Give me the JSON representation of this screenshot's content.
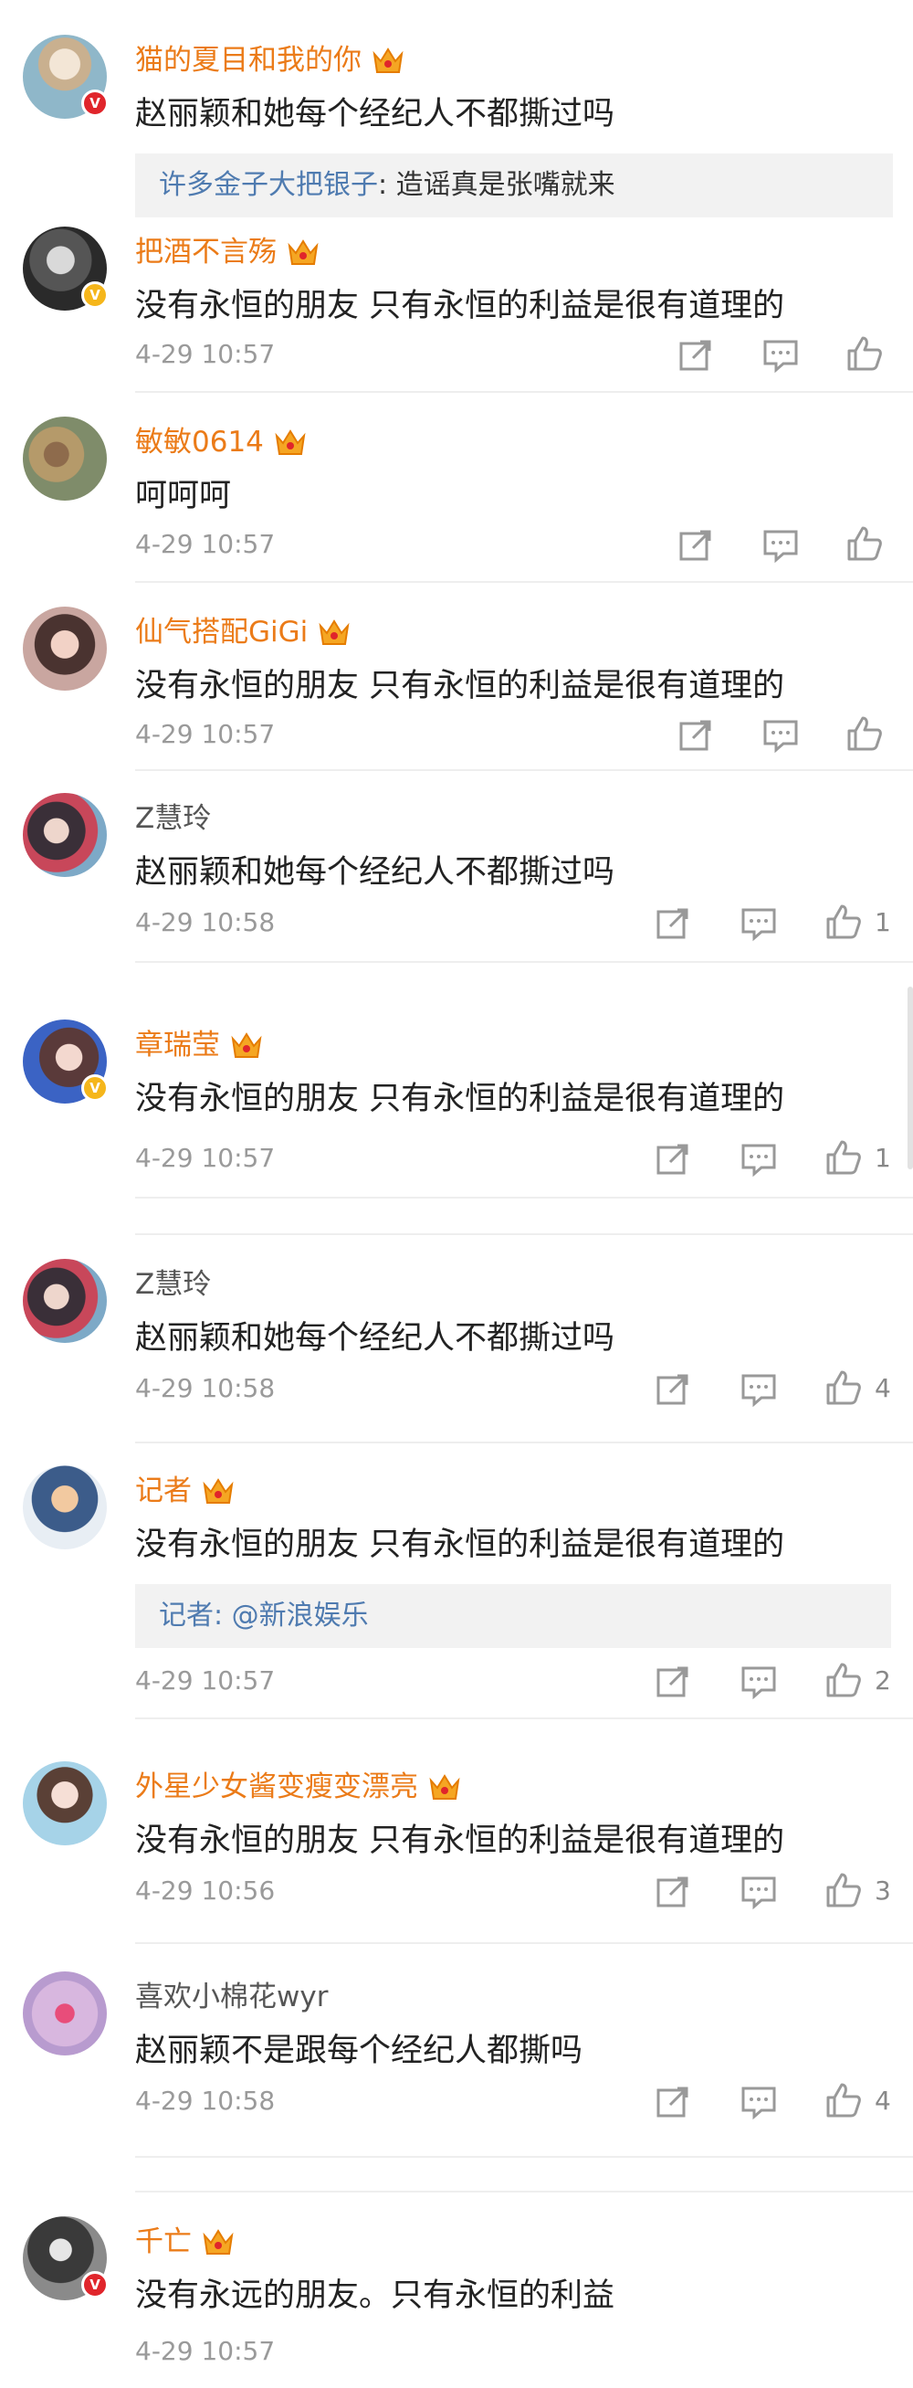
{
  "comments": [
    {
      "name": "猫的夏目和我的你",
      "vip": true,
      "badge": "red",
      "text": "赵丽颖和她每个经纪人不都撕过吗",
      "reply": {
        "name": "许多金子大把银子",
        "text": ": 造谣真是张嘴就来"
      },
      "time": "",
      "likes": ""
    },
    {
      "name": "把酒不言殇",
      "vip": true,
      "badge": "gold",
      "text": "没有永恒的朋友 只有永恒的利益是很有道理的",
      "time": "4-29 10:57",
      "likes": ""
    },
    {
      "name": "敏敏0614",
      "vip": true,
      "badge": "",
      "text": "呵呵呵",
      "time": "4-29 10:57",
      "likes": ""
    },
    {
      "name": "仙气搭配GiGi",
      "vip": true,
      "badge": "",
      "text": "没有永恒的朋友 只有永恒的利益是很有道理的",
      "time": "4-29 10:57",
      "likes": ""
    },
    {
      "name": "Z慧玲",
      "vip": false,
      "badge": "",
      "text": "赵丽颖和她每个经纪人不都撕过吗",
      "time": "4-29 10:58",
      "likes": "1"
    },
    {
      "name": "章瑞莹",
      "vip": true,
      "badge": "gold",
      "text": "没有永恒的朋友 只有永恒的利益是很有道理的",
      "time": "4-29 10:57",
      "likes": "1"
    },
    {
      "name": "Z慧玲",
      "vip": false,
      "badge": "",
      "text": "赵丽颖和她每个经纪人不都撕过吗",
      "time": "4-29 10:58",
      "likes": "4"
    },
    {
      "name": "记者",
      "vip": true,
      "badge": "",
      "text": "没有永恒的朋友 只有永恒的利益是很有道理的",
      "reply": {
        "name": "记者",
        "text": ": @新浪娱乐"
      },
      "time": "4-29 10:57",
      "likes": "2"
    },
    {
      "name": "外星少女酱变瘦变漂亮",
      "vip": true,
      "badge": "",
      "text": "没有永恒的朋友 只有永恒的利益是很有道理的",
      "time": "4-29 10:56",
      "likes": "3"
    },
    {
      "name": "喜欢小棉花wyr",
      "vip": false,
      "badge": "",
      "text": "赵丽颖不是跟每个经纪人都撕吗",
      "time": "4-29 10:58",
      "likes": "4"
    },
    {
      "name": "千亡",
      "vip": true,
      "badge": "red",
      "text": "没有永远的朋友。只有永恒的利益",
      "time": "4-29 10:57",
      "likes": ""
    }
  ],
  "colors": {
    "vip_name": "#eb7b18",
    "plain_name": "#555555",
    "reply_name": "#4f7bb0",
    "time": "#9a9a9a",
    "badge_red": "#e0252b",
    "badge_gold": "#f5b61b"
  },
  "icons": [
    "repost-icon",
    "comment-icon",
    "like-icon",
    "vip-crown-icon",
    "verified-v-icon"
  ],
  "badge_glyph": "V"
}
